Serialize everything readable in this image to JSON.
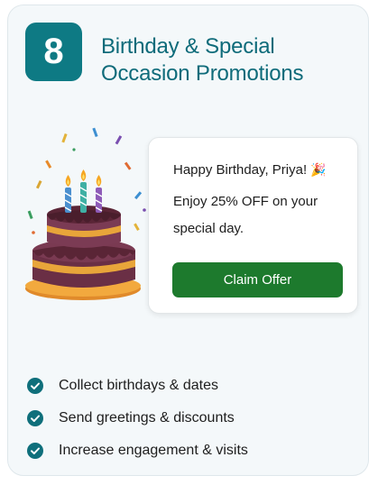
{
  "card": {
    "number": "8",
    "title_line1": "Birthday & Special",
    "title_line2": "Occasion Promotions"
  },
  "popup": {
    "greeting": "Happy Birthday, Priya!",
    "greeting_icon": "party-popper-icon",
    "offer_line1": "Enjoy 25% OFF on your",
    "offer_line2": "special day.",
    "button_label": "Claim Offer"
  },
  "benefits": [
    {
      "text": "Collect birthdays & dates"
    },
    {
      "text": "Send greetings & discounts"
    },
    {
      "text": "Increase engagement & visits"
    }
  ],
  "colors": {
    "teal": "#0e7a84",
    "title": "#0e6b7a",
    "button_green": "#1d7a2d"
  }
}
